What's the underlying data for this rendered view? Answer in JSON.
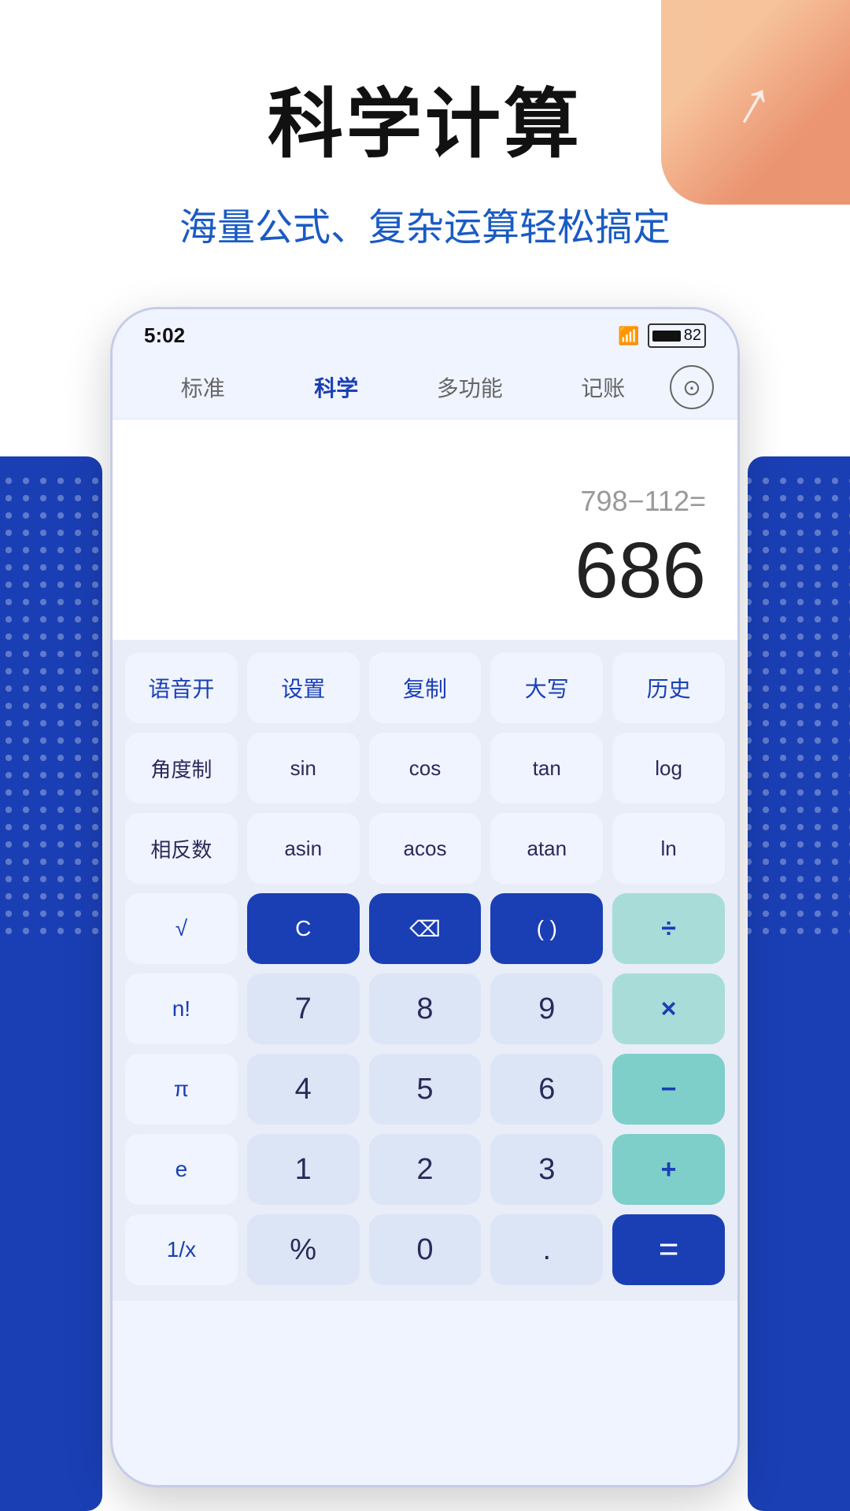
{
  "page": {
    "background_color": "#ffffff",
    "blue_accent": "#1a3fb5"
  },
  "top": {
    "main_title": "科学计算",
    "subtitle": "海量公式、复杂运算轻松搞定"
  },
  "status_bar": {
    "time": "5:02",
    "battery": "82"
  },
  "nav": {
    "tabs": [
      {
        "label": "标准",
        "active": false
      },
      {
        "label": "科学",
        "active": true
      },
      {
        "label": "多功能",
        "active": false
      },
      {
        "label": "记账",
        "active": false
      }
    ],
    "profile_icon": "👤"
  },
  "display": {
    "expression": "798−112=",
    "result": "686"
  },
  "keyboard": {
    "row1": [
      {
        "label": "语音开",
        "type": "light"
      },
      {
        "label": "设置",
        "type": "light"
      },
      {
        "label": "复制",
        "type": "light"
      },
      {
        "label": "大写",
        "type": "light"
      },
      {
        "label": "历史",
        "type": "light"
      }
    ],
    "row2": [
      {
        "label": "角度制",
        "type": "func"
      },
      {
        "label": "sin",
        "type": "func"
      },
      {
        "label": "cos",
        "type": "func"
      },
      {
        "label": "tan",
        "type": "func"
      },
      {
        "label": "log",
        "type": "func"
      }
    ],
    "row3": [
      {
        "label": "相反数",
        "type": "func"
      },
      {
        "label": "asin",
        "type": "func"
      },
      {
        "label": "acos",
        "type": "func"
      },
      {
        "label": "atan",
        "type": "func"
      },
      {
        "label": "ln",
        "type": "func"
      }
    ],
    "row4": [
      {
        "label": "√",
        "type": "light"
      },
      {
        "label": "C",
        "type": "blue_dark"
      },
      {
        "label": "⌫",
        "type": "blue_dark"
      },
      {
        "label": "( )",
        "type": "blue_dark"
      },
      {
        "label": "÷",
        "type": "teal"
      }
    ],
    "row5": [
      {
        "label": "n!",
        "type": "light"
      },
      {
        "label": "7",
        "type": "number"
      },
      {
        "label": "8",
        "type": "number"
      },
      {
        "label": "9",
        "type": "number"
      },
      {
        "label": "×",
        "type": "teal"
      }
    ],
    "row6": [
      {
        "label": "π",
        "type": "light"
      },
      {
        "label": "4",
        "type": "number"
      },
      {
        "label": "5",
        "type": "number"
      },
      {
        "label": "6",
        "type": "number"
      },
      {
        "label": "−",
        "type": "teal_dark"
      }
    ],
    "row7": [
      {
        "label": "e",
        "type": "light"
      },
      {
        "label": "1",
        "type": "number"
      },
      {
        "label": "2",
        "type": "number"
      },
      {
        "label": "3",
        "type": "number"
      },
      {
        "label": "+",
        "type": "teal_dark"
      }
    ],
    "row8": [
      {
        "label": "1/x",
        "type": "light"
      },
      {
        "label": "%",
        "type": "number"
      },
      {
        "label": "0",
        "type": "number"
      },
      {
        "label": ".",
        "type": "number"
      },
      {
        "label": "=",
        "type": "equal"
      }
    ]
  }
}
